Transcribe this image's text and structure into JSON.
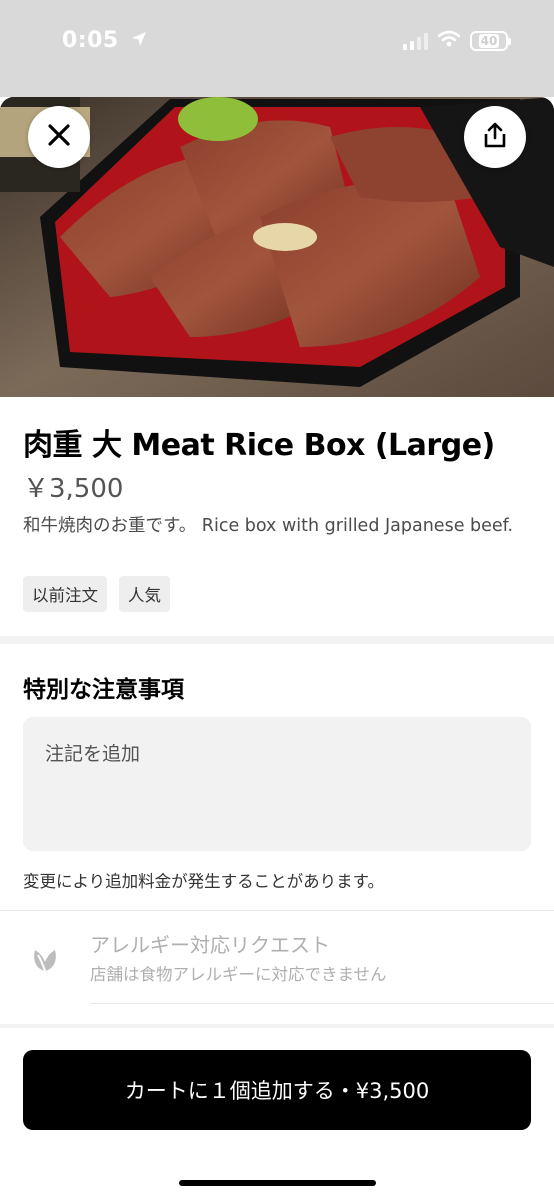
{
  "status_bar": {
    "time": "0:05",
    "battery": "40"
  },
  "item": {
    "title": "肉重 大 Meat Rice Box (Large)",
    "price": "￥3,500",
    "description": "和牛焼肉のお重です。 Rice box with grilled Japanese beef.",
    "tags": [
      "以前注文",
      "人気"
    ]
  },
  "instructions": {
    "heading": "特別な注意事項",
    "placeholder": "注記を追加",
    "hint": "変更により追加料金が発生することがあります。"
  },
  "allergy": {
    "title": "アレルギー対応リクエスト",
    "subtitle": "店舗は食物アレルギーに対応できません"
  },
  "cart_button": {
    "label": "カートに１個追加する・¥3,500"
  },
  "colors": {
    "button_bg": "#000000",
    "muted_text": "#afafaf",
    "field_bg": "#f2f2f2"
  }
}
